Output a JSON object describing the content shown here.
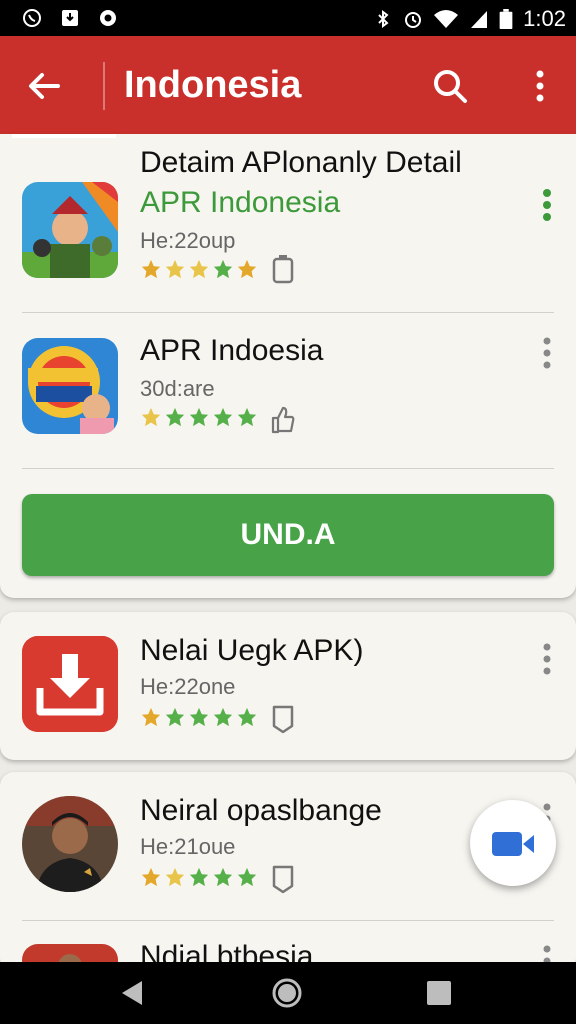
{
  "status_bar": {
    "time": "1:02",
    "left_icons": [
      "whatsapp-icon",
      "download-box-icon",
      "messenger-icon"
    ],
    "right_icons": [
      "bluetooth-icon",
      "alarm-icon",
      "wifi-icon",
      "signal-icon",
      "battery-icon"
    ]
  },
  "app_bar": {
    "title": "Indonesia",
    "icons": [
      "back-arrow-icon",
      "search-icon",
      "more-vert-icon"
    ],
    "color": "#c9302c"
  },
  "list": {
    "items": [
      {
        "heading": "Detaim APlonanly Detail",
        "title": "APR Indonesia",
        "subtitle": "He:22oup",
        "rating_stars": 5,
        "icon": "cartoon-soldier-app-icon",
        "tag_icon": "battery-outline-icon"
      },
      {
        "title": "APR Indoesia",
        "subtitle": "30d:are",
        "rating_stars": 5,
        "icon": "bomb-jam-uadn-app-icon",
        "tag_icon": "thumbs-up-outline-icon"
      },
      {
        "title": "Nelai Uegk APK)",
        "subtitle": "He:22one",
        "rating_stars": 5,
        "icon": "download-app-icon",
        "tag_icon": "tag-outline-icon"
      },
      {
        "title": "Neiral opaslbange",
        "subtitle": "He:21oue",
        "rating_stars": 5,
        "icon": "person-avatar-icon",
        "tag_icon": "tag-outline-icon"
      },
      {
        "title": "Ndial btbesia"
      }
    ],
    "install_button_label": "UND.A",
    "accent_green": "#47a248"
  },
  "fab": {
    "icon": "video-camera-icon"
  },
  "nav_bar": {
    "icons": [
      "nav-back-icon",
      "nav-home-icon",
      "nav-recents-icon"
    ]
  }
}
